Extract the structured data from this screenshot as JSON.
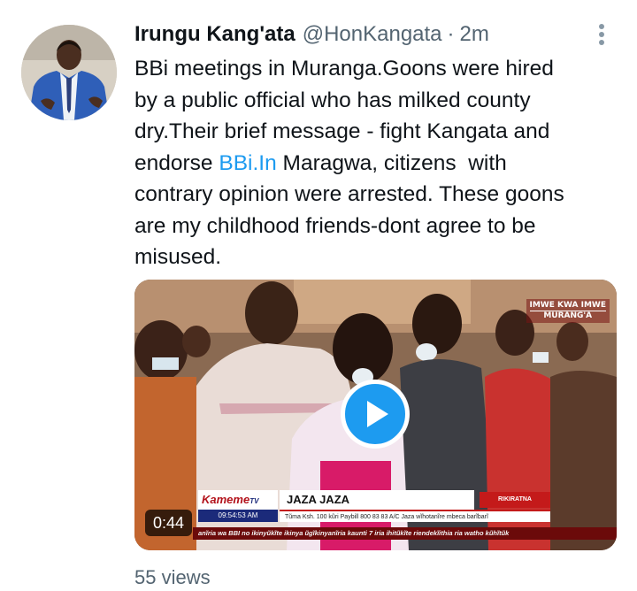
{
  "tweet": {
    "author": {
      "name": "Irungu Kang'ata",
      "handle": "@HonKangata",
      "separator": "·",
      "time": "2m"
    },
    "body_lines": [
      "BBi meetings in Muranga.Goons were hired",
      "by a public official who has milked county",
      "dry.Their brief message - fight Kangata and"
    ],
    "body_pre_link": "endorse ",
    "body_link": "BBi.In",
    "body_post_link_lines": [
      " Maragwa, citizens  with",
      "contrary opinion were arrested. These goons",
      "are my childhood friends-dont agree to be",
      "misused."
    ],
    "media": {
      "duration": "0:44",
      "channel_tag_line1": "IMWE KWA IMWE",
      "channel_tag_line2": "MURANG'A",
      "lower_third": {
        "logo": "Kameme",
        "logo_suffix": "TV",
        "time": "09:54:53 AM",
        "title": "JAZA JAZA",
        "subtitle": "Tũma Ksh. 100 kũri Paybill 800 83 83 A/C Jaza wĩhotanĩre mbeca barĩbarĩ",
        "badge": "RIKIRATNA",
        "ticker": "anĩria wa BBI no ikinyũkĩte ikinya ũgĩkinyanĩria kaunti 7 iria ihitũkĩte riendekĩithia ria watho kũhĩtũk"
      }
    },
    "views": "55 views"
  },
  "colors": {
    "accent": "#1d9bf0",
    "secondary_text": "#536471",
    "text": "#0f1419"
  },
  "icons": {
    "more": "more-vertical-icon",
    "play": "play-icon"
  }
}
